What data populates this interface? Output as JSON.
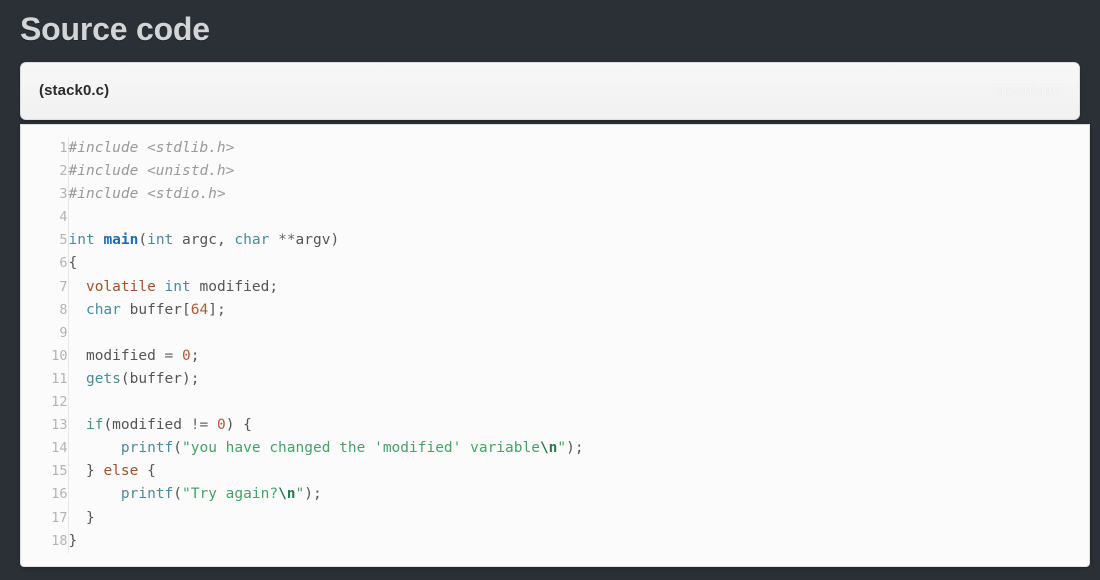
{
  "page": {
    "title": "Source code",
    "background_color": "#2b2f36"
  },
  "card": {
    "file_name": "(stack0.c)",
    "download_label": "download"
  },
  "code": {
    "language": "c",
    "line_numbers": [
      "1",
      "2",
      "3",
      "4",
      "5",
      "6",
      "7",
      "8",
      "9",
      "10",
      "11",
      "12",
      "13",
      "14",
      "15",
      "16",
      "17",
      "18"
    ],
    "lines": [
      "#include <stdlib.h>",
      "#include <unistd.h>",
      "#include <stdio.h>",
      "",
      "int main(int argc, char **argv)",
      "{",
      "  volatile int modified;",
      "  char buffer[64];",
      "",
      "  modified = 0;",
      "  gets(buffer);",
      "",
      "  if(modified != 0) {",
      "      printf(\"you have changed the 'modified' variable\\n\");",
      "  } else {",
      "      printf(\"Try again?\\n\");",
      "  }",
      "}"
    ]
  },
  "theme": {
    "preprocessor": "#999999",
    "type": "#4a8a9a",
    "function_def": "#1a6fb5",
    "keyword": "#a0522d",
    "keyword_control": "#3d9970",
    "string": "#47a06a",
    "escape": "#2b7a52",
    "number": "#b05a3c",
    "plain": "#555555",
    "line_number": "#b3b3b3",
    "code_background": "#fbfbfb",
    "header_background": "#f4f4f4"
  }
}
